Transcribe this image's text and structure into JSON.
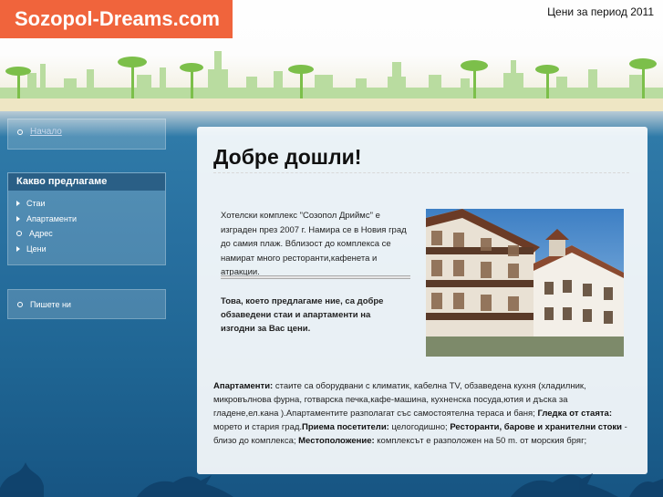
{
  "header": {
    "logo": "Sozopol-Dreams.com",
    "period": "Цени за период 2011"
  },
  "sidebar": {
    "home": "Начало",
    "menu_title": "Какво предлагаме",
    "menu_items": [
      "Стаи",
      "Апартаменти",
      "Адрес",
      "Цени"
    ],
    "write": "Пишете ни"
  },
  "main": {
    "title": "Добре дошли!",
    "intro": "Хотелски комплекс \"Созопол Дриймс\" е изграден през 2007 г. Намира се в Новия град до самия плаж. Вблизост до комплекса се намират много ресторанти,кафенета и атракции.",
    "offer": "Това, което предлагаме ние, са добре обзаведени стаи и апартаменти на изгодни за Вас цени.",
    "details": {
      "apartments_label": "Апартаменти:",
      "apartments_text": " стаите са оборудвани с климатик, кабелна TV, обзаведена кухня (хладилник, микровълнова фурна, готварска печка,кафе-машина, кухненска посуда,ютия и дъска за гладене,ел.кана ).Апартаментите разполагат със самостоятелна  тераса и баня; ",
      "view_label": "Гледка от стаята:",
      "view_text": " морето и стария град.",
      "guests_label": "Приема посетители:",
      "guests_text": " целогодишно; ",
      "restaurants_label": "Ресторанти, барове и хранителни стоки",
      "restaurants_text": " - близо до комплекса; ",
      "location_label": "Местоположение:",
      "location_text": " комплексът е разположен на 50 m. от морския бряг;"
    }
  },
  "colors": {
    "logo_bg": "#f0643c",
    "menu_title_bg": "#2a5f86",
    "sea": "#1f6593"
  }
}
